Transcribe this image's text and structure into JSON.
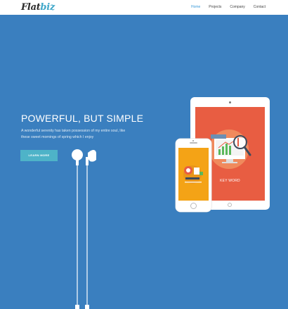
{
  "header": {
    "logo_main": "Flat",
    "logo_accent": "biz",
    "nav": [
      {
        "label": "Home",
        "active": true
      },
      {
        "label": "Projects",
        "active": false
      },
      {
        "label": "Company",
        "active": false
      },
      {
        "label": "Contact",
        "active": false
      }
    ]
  },
  "hero": {
    "headline": "POWERFUL, BUT SIMPLE",
    "subtext": "A wonderful serenity has taken possession of my entire soul, like these sweet mornings of spring which I enjoy",
    "cta_label": "LEARN MORE",
    "tablet_caption": "KEY WORD"
  },
  "colors": {
    "hero_bg": "#3a7fbf",
    "button": "#4eb3c8",
    "tablet_screen": "#e85d42",
    "phone_screen": "#f4a316",
    "nav_active": "#3a9ad9"
  },
  "icons": [
    "earphones-illustration",
    "tablet-illustration",
    "phone-illustration",
    "magnifier-icon",
    "chart-icon"
  ]
}
